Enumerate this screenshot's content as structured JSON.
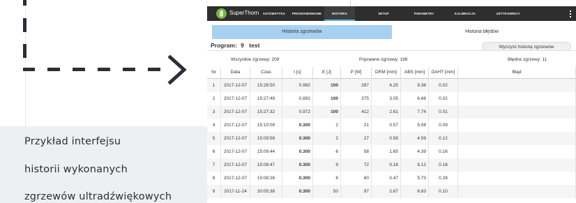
{
  "caption": {
    "lines": [
      "Przykład interfejsu",
      "historii wykonanych",
      "zgrzewów ultradźwiękowych"
    ]
  },
  "app": {
    "title": "SuperThorn",
    "nav": [
      "AUTOMATYKA",
      "PROGRAMOWANIE",
      "HISTORIA",
      "SETUP",
      "PARAMETRY",
      "KALIBRACJA",
      "UŻYTKOWNICY"
    ],
    "active_nav": "HISTORIA",
    "tabs": [
      "Historia zgrzewów",
      "Historia błędów"
    ],
    "active_tab": "Historia zgrzewów"
  },
  "program": {
    "label": "Program:",
    "number": "9",
    "name": "test",
    "clear_button": "Wyczyść historię zgrzewów"
  },
  "stats": {
    "all": "Wszystkie zgrzewy: 209",
    "ok": "Poprawne zgrzewy: 198",
    "bad": "Błędne zgrzewy: 11"
  },
  "table": {
    "columns": [
      "Nr",
      "Data",
      "Czas",
      "t [s]",
      "E [J]",
      "P [W]",
      "DRM [mm]",
      "ABS [mm]",
      "DAHT [mm]",
      "Błąd"
    ],
    "rows": [
      [
        "1",
        "2017-12-07",
        "15:28:50",
        "0.982",
        "100",
        "287",
        "4.25",
        "9.38",
        "0.02",
        ""
      ],
      [
        "2",
        "2017-12-07",
        "15:27:49",
        "0.892",
        "100",
        "375",
        "3.05",
        "6.66",
        "0.02",
        ""
      ],
      [
        "3",
        "2017-12-07",
        "15:27:32",
        "0.972",
        "100",
        "412",
        "2.61",
        "7.74",
        "0.01",
        ""
      ],
      [
        "4",
        "2017-12-07",
        "15:10:09",
        "0.300",
        "2",
        "21",
        "0.57",
        "5.08",
        "0.09",
        ""
      ],
      [
        "5",
        "2017-12-07",
        "15:09:58",
        "0.300",
        "2",
        "27",
        "0.58",
        "4.59",
        "0.12",
        ""
      ],
      [
        "6",
        "2017-12-07",
        "15:09:44",
        "0.300",
        "6",
        "58",
        "1.65",
        "4.39",
        "0.16",
        ""
      ],
      [
        "7",
        "2017-12-07",
        "15:08:47",
        "0.300",
        "9",
        "72",
        "0.16",
        "6.12",
        "0.18",
        ""
      ],
      [
        "8",
        "2017-12-07",
        "15:08:26",
        "0.300",
        "8",
        "60",
        "0.47",
        "5.73",
        "0.28",
        ""
      ],
      [
        "9",
        "2017-11-24",
        "20:05:38",
        "0.300",
        "50",
        "97",
        "2.67",
        "6.83",
        "0.10",
        ""
      ]
    ],
    "bold_t_rows": [
      4,
      5,
      6,
      7,
      8,
      9
    ],
    "bold_e_rows": [
      1,
      2,
      3
    ]
  },
  "colors": {
    "appbar": "#2e2e2e",
    "active_tab": "#a8d0f0",
    "nav_underline": "#5aaee0",
    "logo": "#7cb342",
    "caption_band": "#eeeff1",
    "dash": "#2b2f36"
  }
}
